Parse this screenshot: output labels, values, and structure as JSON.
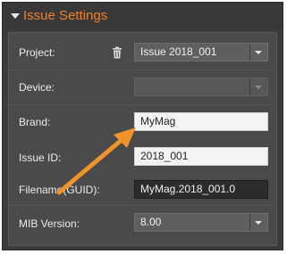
{
  "header": {
    "title": "Issue Settings"
  },
  "fields": {
    "project": {
      "label": "Project:",
      "value": "Issue 2018_001"
    },
    "device": {
      "label": "Device:",
      "value": ""
    },
    "brand": {
      "label": "Brand:",
      "value": "MyMag"
    },
    "issue_id": {
      "label": "Issue ID:",
      "value": "2018_001"
    },
    "filename": {
      "label": "Filename(GUID):",
      "value": "MyMag.2018_001.0"
    },
    "mib_version": {
      "label": "MIB Version:",
      "value": "8.00"
    }
  },
  "icons": {
    "trash": "trash-icon",
    "chevron": "chevron-down-icon",
    "dropdown": "dropdown-arrow-icon"
  },
  "colors": {
    "accent": "#f0802a",
    "annotation_arrow": "#f0942a",
    "panel_bg": "#4a4a4a"
  }
}
